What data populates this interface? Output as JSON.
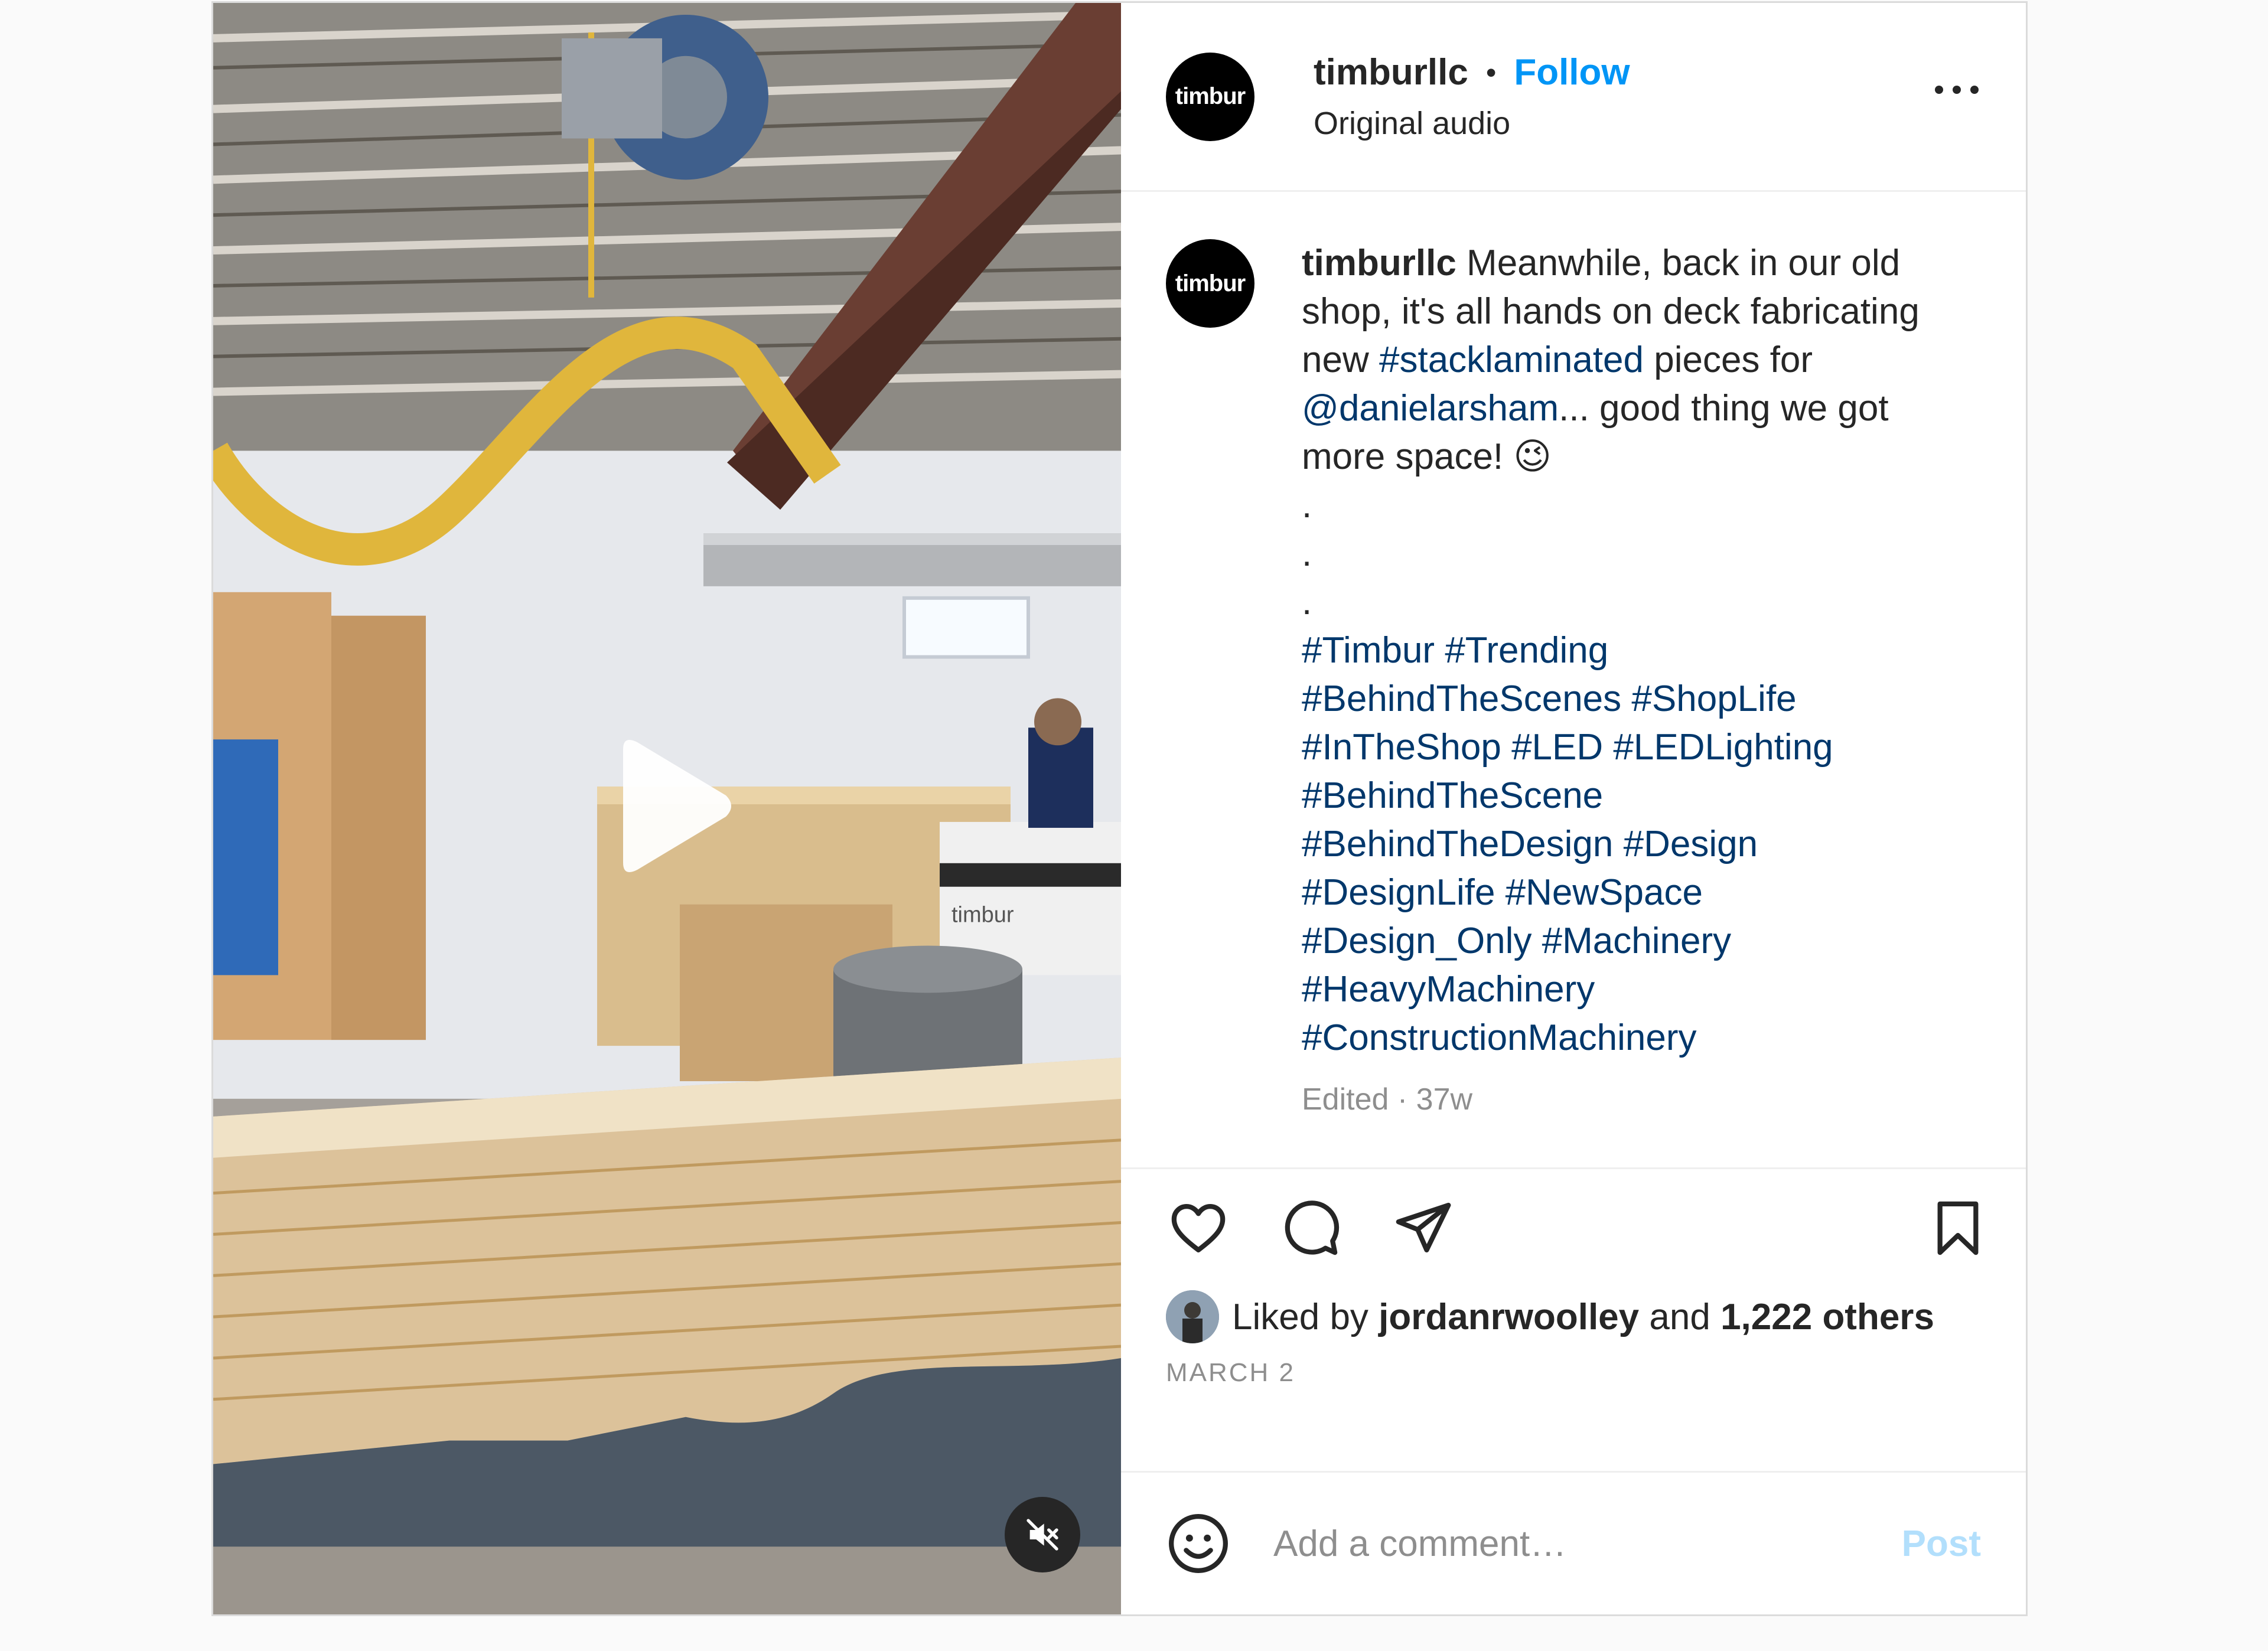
{
  "post": {
    "username": "timburllc",
    "avatar_text": "timbur",
    "follow_label": "Follow",
    "audio": "Original audio"
  },
  "caption": {
    "username": "timburllc",
    "text_1": "Meanwhile, back in our old shop, it's all hands on deck fabricating new",
    "tag_1": "#stacklaminated",
    "text_2": "pieces for",
    "mention": "@danielarsham",
    "text_3": "... good thing we got more space! 😉",
    "dots": [
      ".",
      ".",
      "."
    ],
    "hashtags": [
      "#Timbur",
      "#Trending",
      "#BehindTheScenes",
      "#ShopLife",
      "#InTheShop",
      "#LED",
      "#LEDLighting",
      "#BehindTheScene",
      "#BehindTheDesign",
      "#Design",
      "#DesignLife",
      "#NewSpace",
      "#Design_Only",
      "#Machinery",
      "#HeavyMachinery",
      "#ConstructionMachinery"
    ],
    "edited": "Edited",
    "age": "37w"
  },
  "likes": {
    "prefix": "Liked by",
    "user": "jordanrwoolley",
    "and": "and",
    "others": "1,222 others"
  },
  "date": "MARCH 2",
  "comment": {
    "placeholder": "Add a comment…",
    "post_label": "Post"
  },
  "media": {
    "machine_label": "timbur"
  },
  "icons": {
    "like": "heart-icon",
    "comment": "comment-icon",
    "share": "paper-plane-icon",
    "save": "bookmark-icon",
    "emoji": "smiley-icon",
    "play": "play-icon",
    "mute": "muted-speaker-icon",
    "more": "more-horizontal-icon"
  },
  "colors": {
    "follow": "#0095f6",
    "hashtag": "#00376b",
    "muted_text": "#8e8e8e",
    "post_disabled": "#b2dffc"
  }
}
